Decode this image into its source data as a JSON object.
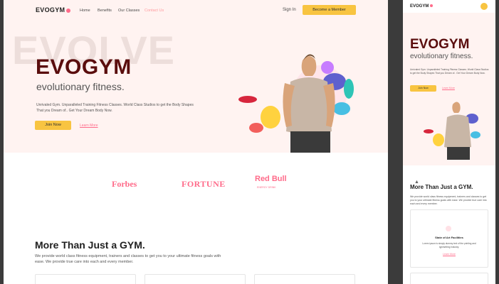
{
  "desktop": {
    "logo": "EVOGYM",
    "nav": [
      "Home",
      "Benefits",
      "Our Classes",
      "Contact Us"
    ],
    "signin": "Sign In",
    "member_button": "Become a Member",
    "hero_bg_text": "EVOLVE",
    "title": "EVOGYM",
    "subtitle": "evolutionary fitness.",
    "description": "Unrivaled Gym. Unparalleled Training Fitness Classes. World Class Studios to get the Body Shapes That you Dream of.. Get Your Dream Body Now.",
    "join_button": "Join Now",
    "learn_more": "Learn More",
    "sponsors": {
      "forbes": "Forbes",
      "fortune": "FORTUNE",
      "redbull": "Red Bull",
      "redbull_sub": "ENERGY DRINK"
    },
    "more_title": "More Than Just a GYM.",
    "more_desc": "We provide world class fitness equipment, trainers and classes to get you to your ultimate fitness goals with ease. We provide true care into each and every member."
  },
  "mobile": {
    "logo": "EVOGYM",
    "title": "EVOGYM",
    "subtitle": "evolutionary fitness.",
    "description": "Unrivaled Gym. Unparalleled Training Fitness Classes. World Class Studios to get the Body Shapes That you Dream of.. Get Your Dream Body Now.",
    "join_button": "Join Now",
    "learn_more": "Learn More",
    "more_title": "More Than Just a GYM.",
    "more_desc": "We provide world class fitness equipment, trainers and classes to get you to your ultimate fitness goals with ease. We provide true care into each and every member.",
    "card": {
      "title": "State of Art Facilities",
      "desc": "Lorem ipsum is simply dummy text of the printing and typesetting industry.",
      "learn": "Learn More"
    }
  },
  "colors": {
    "accent_yellow": "#f8c441",
    "accent_pink": "#ff6b8a",
    "title_red": "#5a0d0d",
    "hero_bg": "#fff3f1"
  }
}
